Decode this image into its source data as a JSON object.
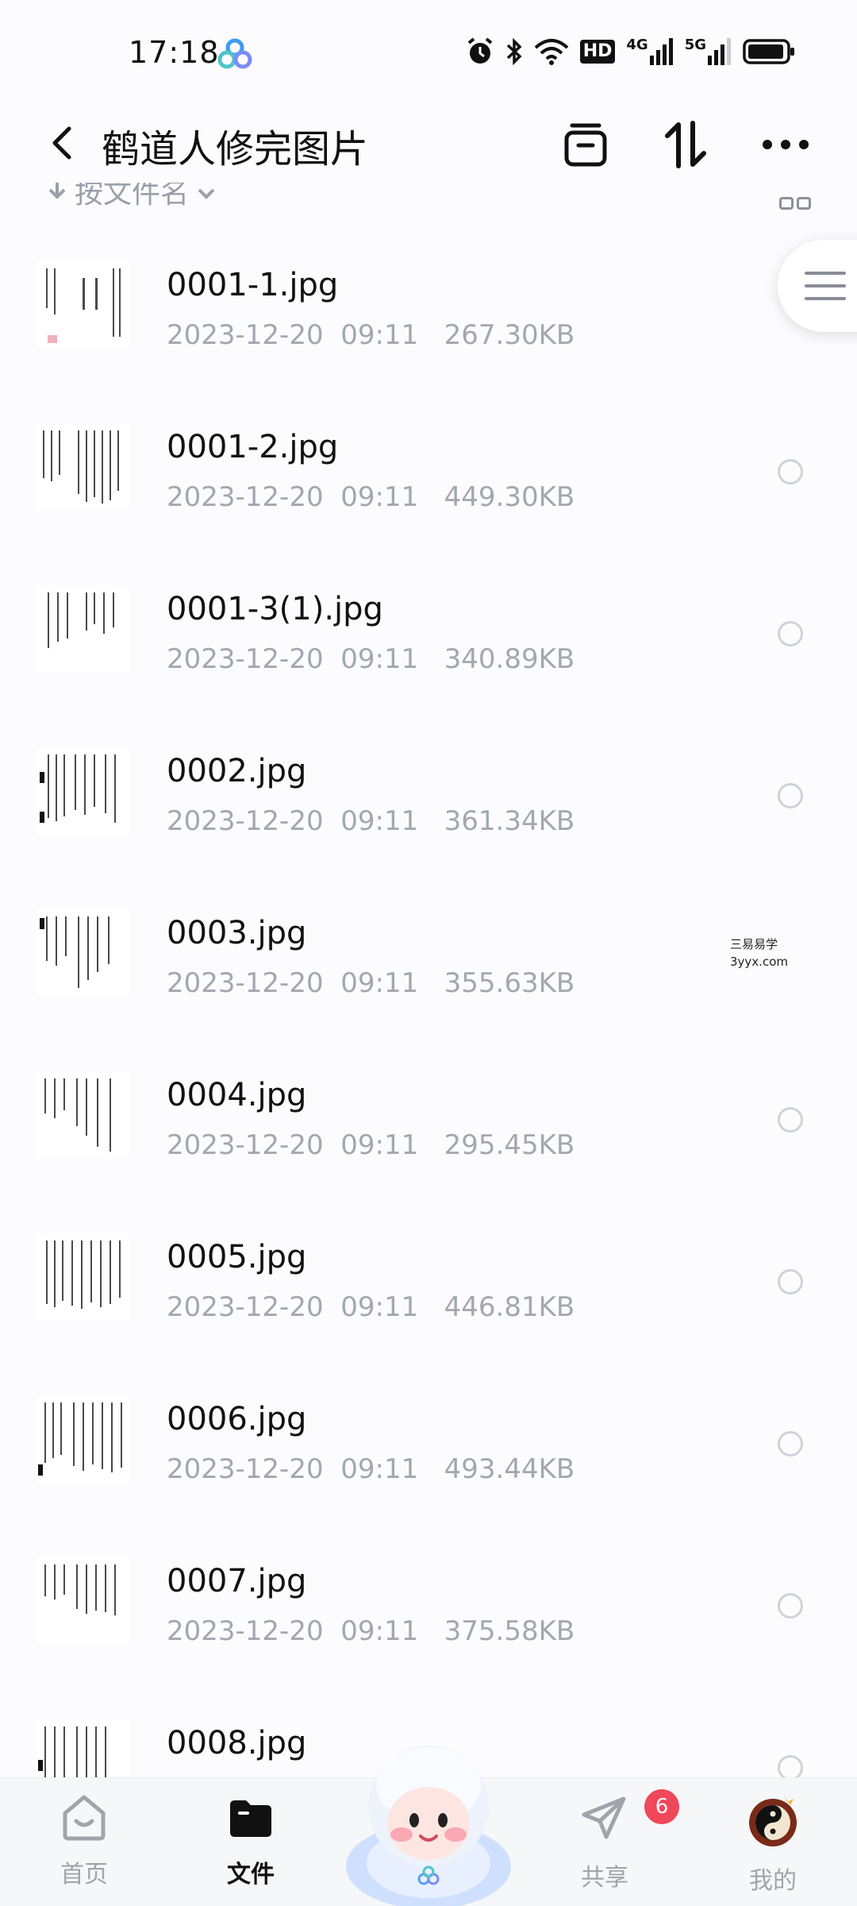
{
  "status_bar": {
    "time": "17:18",
    "hd_label": "HD",
    "net1": "4G",
    "net2": "5G",
    "icons": [
      "app-icon",
      "alarm-icon",
      "bluetooth-icon",
      "wifi-icon",
      "signal-icon",
      "battery-icon"
    ]
  },
  "header": {
    "title": "鹤道人修完图片"
  },
  "sort_bar": {
    "label": "按文件名"
  },
  "files": [
    {
      "name": "0001-1.jpg",
      "date": "2023-12-20",
      "time": "09:11",
      "size": "267.30KB"
    },
    {
      "name": "0001-2.jpg",
      "date": "2023-12-20",
      "time": "09:11",
      "size": "449.30KB"
    },
    {
      "name": "0001-3(1).jpg",
      "date": "2023-12-20",
      "time": "09:11",
      "size": "340.89KB"
    },
    {
      "name": "0002.jpg",
      "date": "2023-12-20",
      "time": "09:11",
      "size": "361.34KB"
    },
    {
      "name": "0003.jpg",
      "date": "2023-12-20",
      "time": "09:11",
      "size": "355.63KB"
    },
    {
      "name": "0004.jpg",
      "date": "2023-12-20",
      "time": "09:11",
      "size": "295.45KB"
    },
    {
      "name": "0005.jpg",
      "date": "2023-12-20",
      "time": "09:11",
      "size": "446.81KB"
    },
    {
      "name": "0006.jpg",
      "date": "2023-12-20",
      "time": "09:11",
      "size": "493.44KB"
    },
    {
      "name": "0007.jpg",
      "date": "2023-12-20",
      "time": "09:11",
      "size": "375.58KB"
    },
    {
      "name": "0008.jpg",
      "date": "",
      "time": "",
      "size": ""
    }
  ],
  "watermark": {
    "line1": "三易易学",
    "line2": "3yyx.com"
  },
  "bottom_nav": {
    "items": [
      {
        "label": "首页",
        "icon": "home-icon"
      },
      {
        "label": "文件",
        "icon": "folder-icon"
      },
      {
        "label": "共享",
        "icon": "share-icon"
      },
      {
        "label": "我的",
        "icon": "profile-avatar-icon"
      }
    ],
    "share_badge": "6"
  },
  "colors": {
    "accent_badge": "#f0475a",
    "meta_text": "#a3a7ae",
    "background": "#fcfcfe"
  }
}
